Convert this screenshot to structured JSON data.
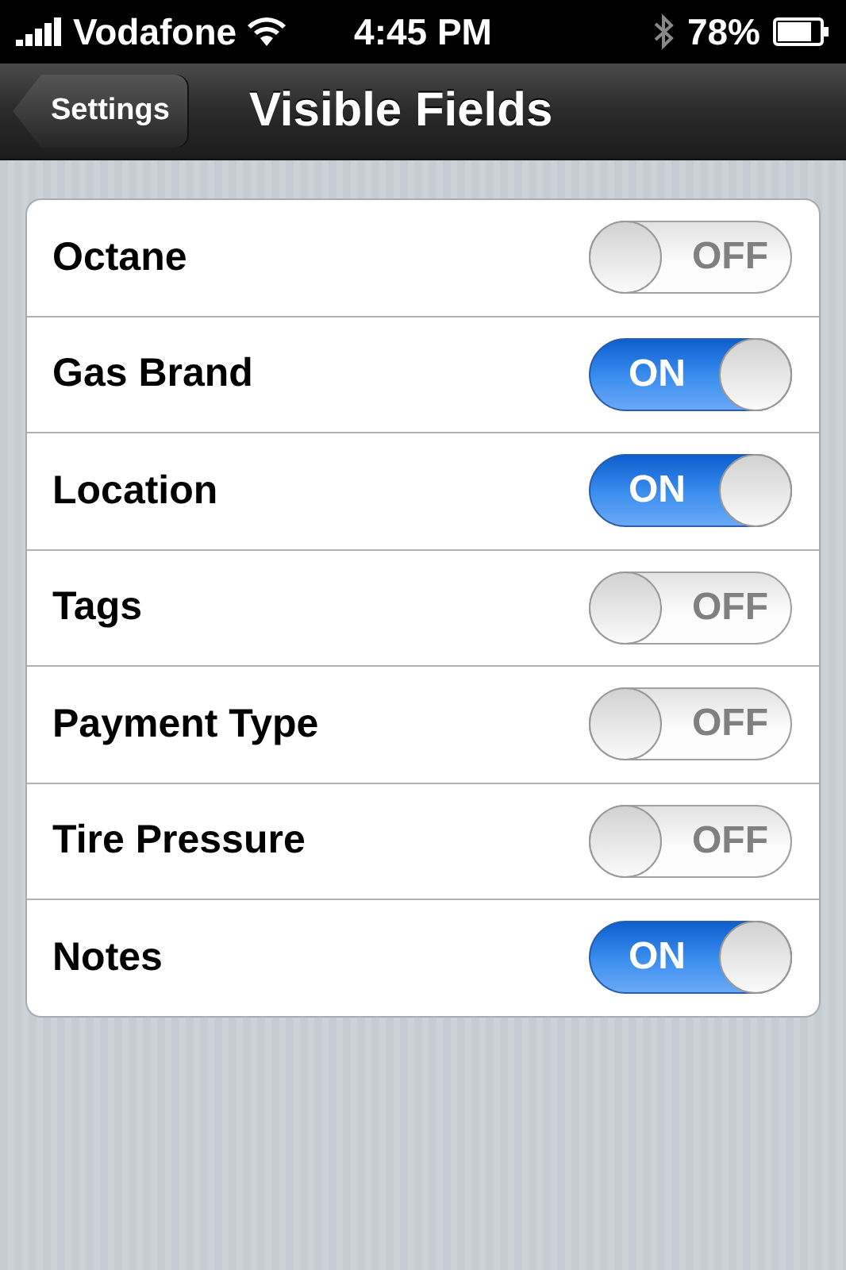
{
  "status_bar": {
    "carrier": "Vodafone",
    "time": "4:45 PM",
    "battery": "78%"
  },
  "nav_bar": {
    "back_button": "Settings",
    "title": "Visible Fields"
  },
  "fields": [
    {
      "label": "Octane",
      "on": false,
      "switch_text": "OFF"
    },
    {
      "label": "Gas Brand",
      "on": true,
      "switch_text": "ON"
    },
    {
      "label": "Location",
      "on": true,
      "switch_text": "ON"
    },
    {
      "label": "Tags",
      "on": false,
      "switch_text": "OFF"
    },
    {
      "label": "Payment Type",
      "on": false,
      "switch_text": "OFF"
    },
    {
      "label": "Tire Pressure",
      "on": false,
      "switch_text": "OFF"
    },
    {
      "label": "Notes",
      "on": true,
      "switch_text": "ON"
    }
  ]
}
